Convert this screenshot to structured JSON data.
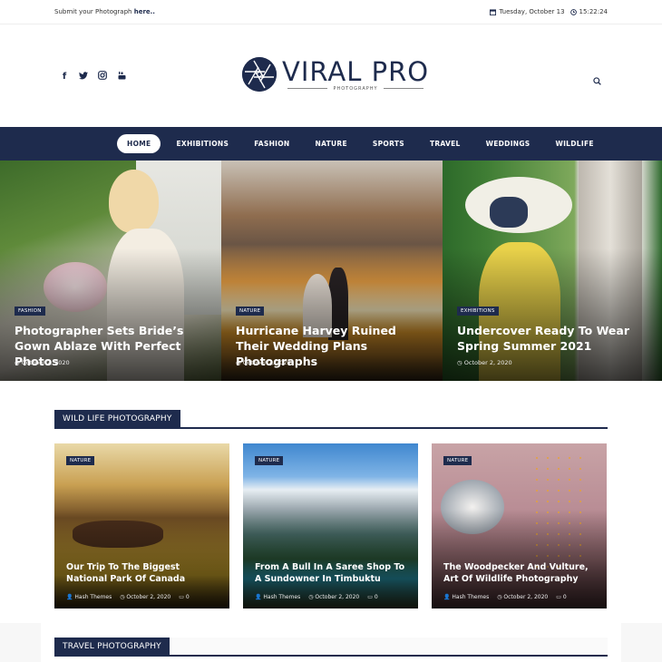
{
  "topbar": {
    "submit_text": "Submit your Photograph ",
    "submit_link": "here..",
    "date": "Tuesday, October 13",
    "time": "15:22:24",
    "calendar_icon": "calendar-icon",
    "clock_icon": "clock-icon"
  },
  "header": {
    "social": [
      {
        "name": "facebook-icon",
        "glyph": "f"
      },
      {
        "name": "twitter-icon",
        "glyph": "🐦"
      },
      {
        "name": "instagram-icon",
        "glyph": "◎"
      },
      {
        "name": "youtube-icon",
        "glyph": "▶"
      }
    ],
    "logo_title": "VIRAL PRO",
    "logo_subtitle": "PHOTOGRAPHY",
    "search_icon": "search-icon"
  },
  "nav": {
    "items": [
      "HOME",
      "EXHIBITIONS",
      "FASHION",
      "NATURE",
      "SPORTS",
      "TRAVEL",
      "WEDDINGS",
      "WILDLIFE"
    ],
    "active": "HOME"
  },
  "hero": [
    {
      "category": "FASHION",
      "title": "Photographer Sets Bride’s Gown Ablaze With Perfect Photos",
      "date": "October 2, 2020"
    },
    {
      "category": "NATURE",
      "title": "Hurricane Harvey Ruined Their Wedding Plans Photographs",
      "date": "October 2, 2020"
    },
    {
      "category": "EXHIBITIONS",
      "title": "Undercover Ready To Wear Spring Summer 2021",
      "date": "October 2, 2020"
    }
  ],
  "sections": {
    "wildlife": {
      "title": "WILD LIFE PHOTOGRAPHY",
      "posts": [
        {
          "category": "NATURE",
          "title": "Our Trip To The Biggest National Park Of Canada",
          "author": "Hash Themes",
          "date": "October 2, 2020",
          "comments": "0"
        },
        {
          "category": "NATURE",
          "title": "From A Bull In A Saree Shop To A Sundowner In Timbuktu",
          "author": "Hash Themes",
          "date": "October 2, 2020",
          "comments": "0"
        },
        {
          "category": "NATURE",
          "title": "The Woodpecker And Vulture, Art Of Wildlife Photography",
          "author": "Hash Themes",
          "date": "October 2, 2020",
          "comments": "0"
        }
      ]
    },
    "travel": {
      "title": "TRAVEL PHOTOGRAPHY"
    }
  },
  "colors": {
    "brand": "#1e2b4d"
  }
}
